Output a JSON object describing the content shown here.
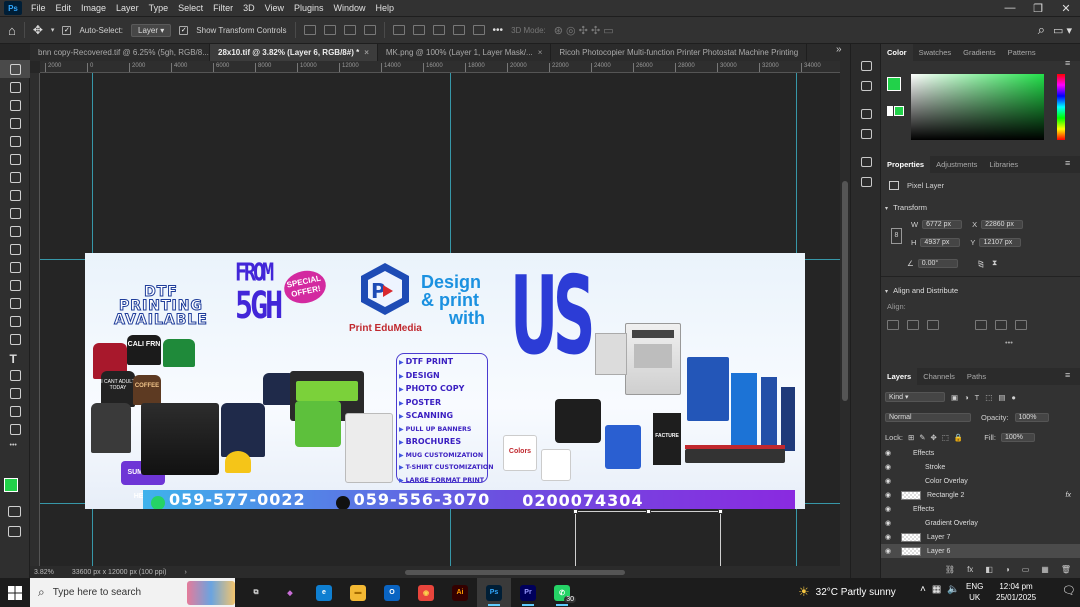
{
  "menu": {
    "logo": "Ps",
    "items": [
      "File",
      "Edit",
      "Image",
      "Layer",
      "Type",
      "Select",
      "Filter",
      "3D",
      "View",
      "Plugins",
      "Window",
      "Help"
    ],
    "window_controls": [
      "—",
      "❐",
      "✕"
    ]
  },
  "options_bar": {
    "auto_select_label": "Auto-Select:",
    "auto_select_target": "Layer",
    "show_transform_label": "Show Transform Controls",
    "mode_3d_label": "3D Mode:",
    "more": "•••"
  },
  "tabs": [
    {
      "label": "bnn copy-Recovered.tif @ 6.25% (5gh, RGB/8...",
      "close": "×"
    },
    {
      "label": "28x10.tif @ 3.82% (Layer 6, RGB/8#) *",
      "close": "×"
    },
    {
      "label": "MK.png @ 100% (Layer 1, Layer Mask/...",
      "close": "×"
    },
    {
      "label": "Ricoh Photocopier Multi-function Printer Photostat Machine Printing",
      "close": ""
    }
  ],
  "tabs_overflow": "»",
  "ruler_top": [
    "2000",
    "0",
    "2000",
    "4000",
    "6000",
    "8000",
    "10000",
    "12000",
    "14000",
    "16000",
    "18000",
    "20000",
    "22000",
    "24000",
    "26000",
    "28000",
    "30000",
    "32000",
    "34000"
  ],
  "status": {
    "zoom": "3.82%",
    "doc_size": "33600 px x 12000 px (100 ppi)",
    "arrow": "›"
  },
  "banner": {
    "dtf": [
      "DTF",
      "PRINTING",
      "AVAILABLE"
    ],
    "from_text": [
      "FROM",
      "5GH"
    ],
    "special": [
      "SPECIAL",
      "OFFER!"
    ],
    "brand": "Print EduMedia",
    "design": [
      "Design",
      "& print",
      "with"
    ],
    "us": "US",
    "services": [
      "DTF PRINT",
      "DESIGN",
      "PHOTO COPY",
      "POSTER",
      "SCANNING",
      "PULL UP BANNERS",
      "BROCHURES",
      "MUG CUSTOMIZATION",
      "T-SHIRT CUSTOMIZATION",
      "LARGE FORMAT PRINT"
    ],
    "phones": [
      "059-577-0022",
      "059-556-3070",
      "0200074304"
    ],
    "shirt_texts": [
      "CALI FRN",
      "I CANT ADULT TODAY",
      "COFFEE",
      "SUMMER HEAT"
    ],
    "mug_text": "Colors",
    "pull_up_text": "FACTURE"
  },
  "panels": {
    "color_tabs": [
      "Color",
      "Swatches",
      "Gradients",
      "Patterns"
    ],
    "fg_color": "#22d14a",
    "props_tabs": [
      "Properties",
      "Adjustments",
      "Libraries"
    ],
    "pixel_layer": "Pixel Layer",
    "transform_title": "Transform",
    "w": "6772 px",
    "h": "4937 px",
    "x": "22860 px",
    "y": "12107 px",
    "w_label": "W",
    "h_label": "H",
    "x_label": "X",
    "y_label": "Y",
    "angle": "0.00°",
    "align_title": "Align and Distribute",
    "align_label": "Align:",
    "more": "•••",
    "layers_tabs": [
      "Layers",
      "Channels",
      "Paths"
    ],
    "kind": "Kind",
    "blend": "Normal",
    "opacity_label": "Opacity:",
    "opacity": "100%",
    "lock_label": "Lock:",
    "fill_label": "Fill:",
    "fill": "100%",
    "layers": [
      {
        "name": "Effects",
        "indent": 1,
        "eye": true,
        "fx": false,
        "thumb": false
      },
      {
        "name": "Stroke",
        "indent": 2,
        "eye": true,
        "fx": false,
        "thumb": false
      },
      {
        "name": "Color Overlay",
        "indent": 2,
        "eye": true,
        "fx": false,
        "thumb": false
      },
      {
        "name": "Rectangle 2",
        "indent": 0,
        "eye": true,
        "fx": true,
        "thumb": true
      },
      {
        "name": "Effects",
        "indent": 1,
        "eye": true,
        "fx": false,
        "thumb": false
      },
      {
        "name": "Gradient Overlay",
        "indent": 2,
        "eye": true,
        "fx": false,
        "thumb": false
      },
      {
        "name": "Layer 7",
        "indent": 0,
        "eye": true,
        "fx": false,
        "thumb": true
      },
      {
        "name": "Layer 6",
        "indent": 0,
        "eye": true,
        "fx": false,
        "thumb": true
      }
    ],
    "fx_symbol": "fx",
    "bottom_icons": [
      "⛓",
      "fx",
      "◧",
      "◑",
      "▭",
      "▦",
      "🗑"
    ]
  },
  "taskbar": {
    "search_placeholder": "Type here to search",
    "weather": "32°C  Partly sunny",
    "lang": [
      "ENG",
      "UK"
    ],
    "time": "12:04 pm",
    "date": "25/01/2025",
    "whatsapp_badge": "30",
    "apps": [
      {
        "name": "task-view",
        "label": "⧉",
        "bg": "transparent",
        "fg": "#ddd"
      },
      {
        "name": "copilot",
        "label": "◆",
        "bg": "transparent",
        "fg": "#c86dd7"
      },
      {
        "name": "edge",
        "label": "e",
        "bg": "#0f7fd1",
        "fg": "#fff"
      },
      {
        "name": "file-explorer",
        "label": "▬",
        "bg": "#f3b833",
        "fg": "#a56b00"
      },
      {
        "name": "outlook",
        "label": "O",
        "bg": "#0a64c2",
        "fg": "#fff"
      },
      {
        "name": "chrome",
        "label": "◉",
        "bg": "#e8453c",
        "fg": "#fcd34d"
      },
      {
        "name": "illustrator",
        "label": "Ai",
        "bg": "#330000",
        "fg": "#ff9a00"
      },
      {
        "name": "photoshop",
        "label": "Ps",
        "bg": "#001e36",
        "fg": "#31a8ff"
      },
      {
        "name": "premiere",
        "label": "Pr",
        "bg": "#00005b",
        "fg": "#9999ff"
      },
      {
        "name": "whatsapp",
        "label": "✆",
        "bg": "#25d366",
        "fg": "#fff"
      }
    ]
  }
}
